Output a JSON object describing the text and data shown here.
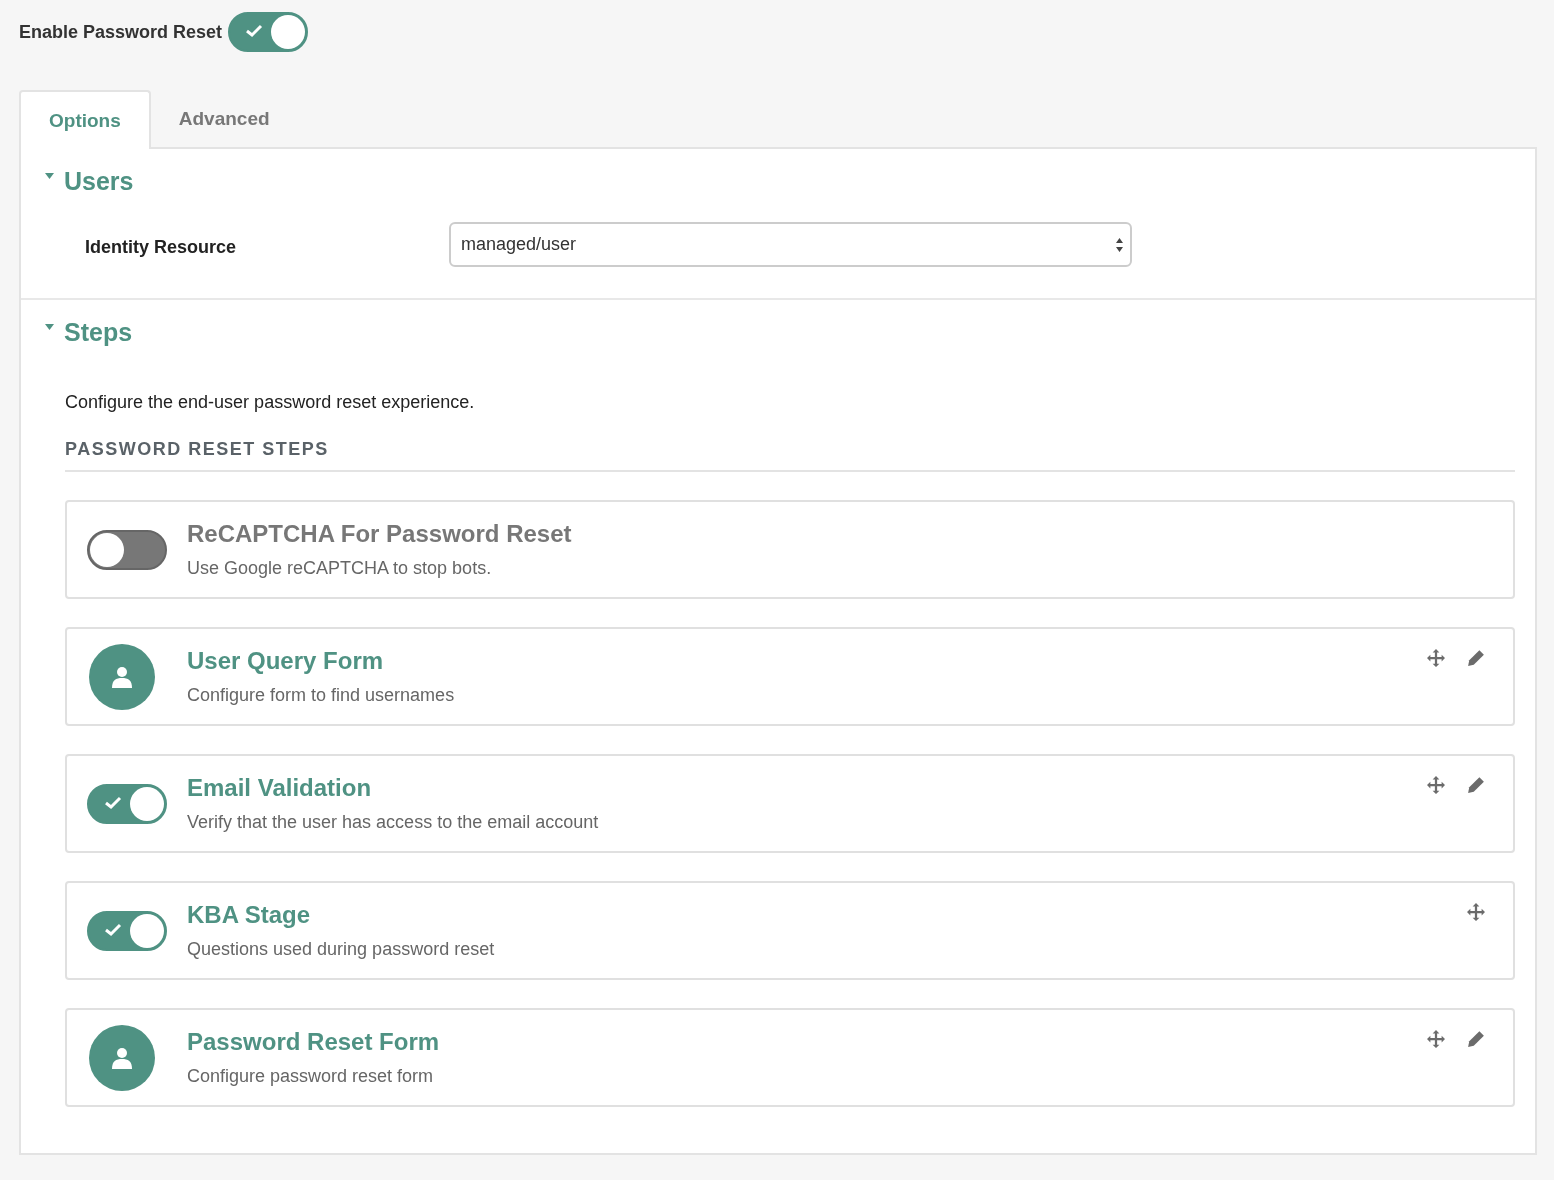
{
  "enable_toggle": {
    "label": "Enable Password Reset",
    "on": true
  },
  "tabs": [
    {
      "label": "Options",
      "selected": true
    },
    {
      "label": "Advanced",
      "selected": false
    }
  ],
  "users_section": {
    "title": "Users",
    "expanded": true,
    "field_label": "Identity Resource",
    "select_value": "managed/user"
  },
  "steps_section": {
    "title": "Steps",
    "expanded": true,
    "description": "Configure the end-user password reset experience.",
    "heading": "PASSWORD RESET STEPS",
    "steps": [
      {
        "kind": "toggle",
        "on": false,
        "title": "ReCAPTCHA For Password Reset",
        "subtitle": "Use Google reCAPTCHA to stop bots.",
        "movable": false,
        "editable": false
      },
      {
        "kind": "avatar",
        "title": "User Query Form",
        "subtitle": "Configure form to find usernames",
        "movable": true,
        "editable": true
      },
      {
        "kind": "toggle",
        "on": true,
        "title": "Email Validation",
        "subtitle": "Verify that the user has access to the email account",
        "movable": true,
        "editable": true
      },
      {
        "kind": "toggle",
        "on": true,
        "title": "KBA Stage",
        "subtitle": "Questions used during password reset",
        "movable": true,
        "editable": false
      },
      {
        "kind": "avatar",
        "title": "Password Reset Form",
        "subtitle": "Configure password reset form",
        "movable": true,
        "editable": true
      }
    ]
  }
}
